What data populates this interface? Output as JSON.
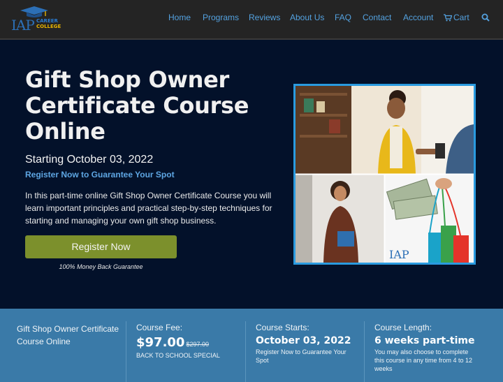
{
  "brand": {
    "logo_letters": "IAP",
    "logo_line1": "CAREER",
    "logo_line2": "COLLEGE",
    "colors": {
      "blue": "#2c6fb6",
      "gold": "#e8b400"
    }
  },
  "nav": {
    "items": [
      "Home",
      "Programs",
      "Reviews",
      "About Us",
      "FAQ",
      "Contact",
      "Account"
    ],
    "cart_label": "Cart",
    "search_icon": "search-icon",
    "link_color": "#54a2e0"
  },
  "hero": {
    "title": "Gift Shop Owner Certificate Course Online",
    "start_text": "Starting October 03, 2022",
    "register_line": "Register Now to Guarantee Your Spot",
    "description": "In this part-time online Gift Shop Owner Certificate Course you will learn important principles and practical step-by-step techniques for starting and managing your own gift shop business.",
    "cta_label": "Register Now",
    "guarantee": "100% Money Back Guarantee",
    "cta_color": "#7c902c",
    "image_border_color": "#2a9be0"
  },
  "info": {
    "course_name": "Gift Shop Owner Certificate Course Online",
    "fee_label": "Course Fee:",
    "fee_price": "$97.00",
    "fee_old_price": "$297.00",
    "fee_note": "BACK TO SCHOOL SPECIAL",
    "starts_label": "Course Starts:",
    "starts_date": "October 03, 2022",
    "starts_note": "Register Now to Guarantee Your Spot",
    "length_label": "Course Length:",
    "length_value": "6 weeks part-time",
    "length_note": "You may also choose to complete this course in any time from 4 to 12 weeks",
    "bar_color": "#3a7aa8"
  }
}
